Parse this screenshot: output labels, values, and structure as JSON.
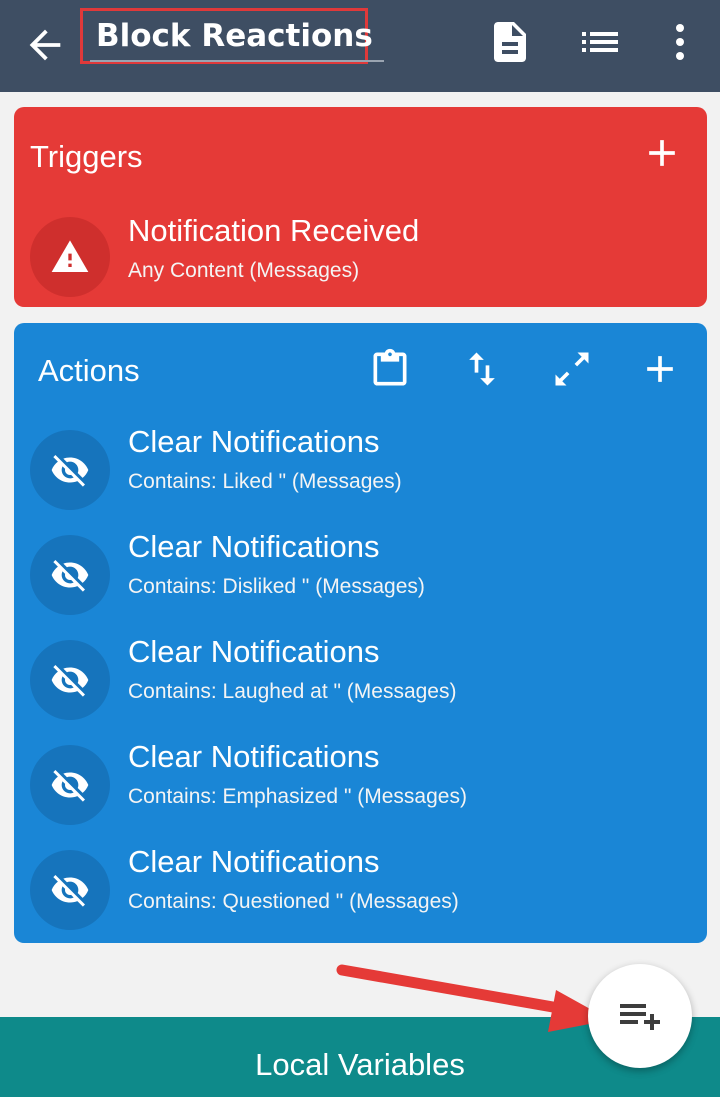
{
  "app_bar": {
    "title": "Block Reactions",
    "icons": [
      "back-arrow-icon",
      "document-icon",
      "list-icon",
      "more-vert-icon"
    ]
  },
  "triggers": {
    "header": "Triggers",
    "items": [
      {
        "title": "Notification Received",
        "subtitle": "Any Content (Messages)",
        "icon": "warning-icon"
      }
    ]
  },
  "actions": {
    "header": "Actions",
    "header_icons": [
      "clipboard-icon",
      "reorder-icon",
      "expand-icon",
      "add-icon"
    ],
    "items": [
      {
        "title": "Clear Notifications",
        "subtitle": "Contains: Liked \" (Messages)",
        "icon": "eye-off-icon"
      },
      {
        "title": "Clear Notifications",
        "subtitle": "Contains: Disliked \" (Messages)",
        "icon": "eye-off-icon"
      },
      {
        "title": "Clear Notifications",
        "subtitle": "Contains: Laughed at \" (Messages)",
        "icon": "eye-off-icon"
      },
      {
        "title": "Clear Notifications",
        "subtitle": "Contains: Emphasized \" (Messages)",
        "icon": "eye-off-icon"
      },
      {
        "title": "Clear Notifications",
        "subtitle": "Contains: Questioned \" (Messages)",
        "icon": "eye-off-icon"
      }
    ]
  },
  "bottom_bar": {
    "label": "Local Variables"
  },
  "fab": {
    "icon": "playlist-add-icon"
  },
  "colors": {
    "app_bar": "#3e4e63",
    "triggers": "#e53a37",
    "actions": "#1a86d6",
    "bottom_bar": "#0e8a8a",
    "highlight": "#e0393a"
  }
}
